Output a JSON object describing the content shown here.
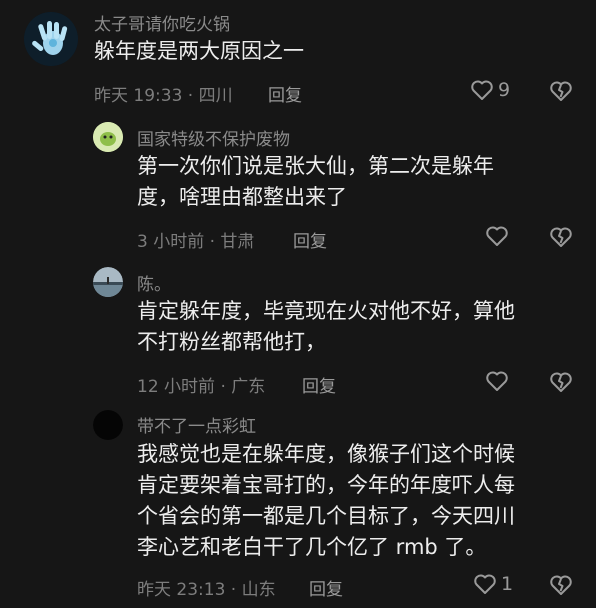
{
  "comments": [
    {
      "username": "太子哥请你吃火锅",
      "text": "躲年度是两大原因之一",
      "meta": "昨天 19:33 · 四川",
      "reply": "回复",
      "likes": "9",
      "avatar_icon": "blue-hand-avatar"
    },
    {
      "username": "国家特级不保护废物",
      "text": "第一次你们说是张大仙，第二次是躲年\n度，啥理由都整出来了",
      "meta": "3 小时前 · 甘肃",
      "reply": "回复",
      "likes": "",
      "avatar_icon": "green-cartoon-avatar"
    },
    {
      "username": "陈。",
      "text": "肯定躲年度，毕竟现在火对他不好，算他\n不打粉丝都帮他打，",
      "meta": "12 小时前 · 广东",
      "reply": "回复",
      "likes": "",
      "avatar_icon": "lake-photo-avatar"
    },
    {
      "username": "带不了一点彩虹",
      "text": "我感觉也是在躲年度，像猴子们这个时候\n肯定要架着宝哥打的，今年的年度吓人每\n个省会的第一都是几个目标了，今天四川\n李心艺和老白干了几个亿了 rmb 了。",
      "meta": "昨天 23:13 · 山东",
      "reply": "回复",
      "likes": "1",
      "avatar_icon": "black-avatar"
    }
  ]
}
